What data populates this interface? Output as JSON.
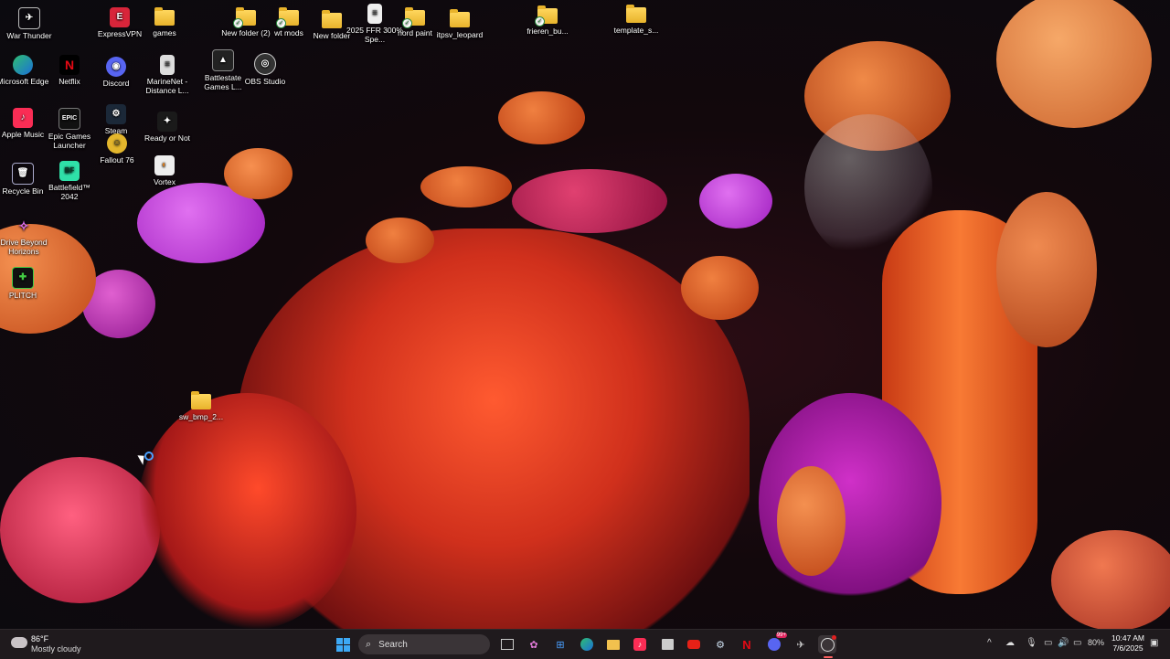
{
  "desktop_icons": {
    "war_thunder": "War Thunder",
    "expressvpn": "ExpressVPN",
    "games": "games",
    "new_folder_2": "New folder (2)",
    "wt_mods": "wt mods",
    "new_folder": "New folder",
    "ffr": "2025 FFR 300% Spe...",
    "nord_paint": "nord paint",
    "itpsv_leopard": "itpsv_leopard",
    "frieren": "frieren_bu...",
    "template": "template_s...",
    "edge": "Microsoft Edge",
    "netflix": "Netflix",
    "discord": "Discord",
    "marinenet": "MarineNet - Distance L...",
    "battlestate": "Battlestate Games L...",
    "obs": "OBS Studio",
    "apple_music": "Apple Music",
    "epic": "Epic Games Launcher",
    "steam": "Steam",
    "ready_or_not": "Ready or Not",
    "fallout": "Fallout 76",
    "vortex": "Vortex",
    "recycle_bin": "Recycle Bin",
    "battlefield": "Battlefield™ 2042",
    "drive_beyond": "Drive Beyond Horizons",
    "plitch": "PLITCH",
    "sw_bmp": "sw_bmp_2..."
  },
  "taskbar": {
    "weather_temp": "86°F",
    "weather_desc": "Mostly cloudy",
    "search_placeholder": "Search",
    "discord_badge": "99+",
    "battery": "80%",
    "time": "10:47 AM",
    "date": "7/6/2025"
  },
  "colors": {
    "taskbar_bg": "#1f1a1d",
    "search_bg": "#3a3437"
  }
}
